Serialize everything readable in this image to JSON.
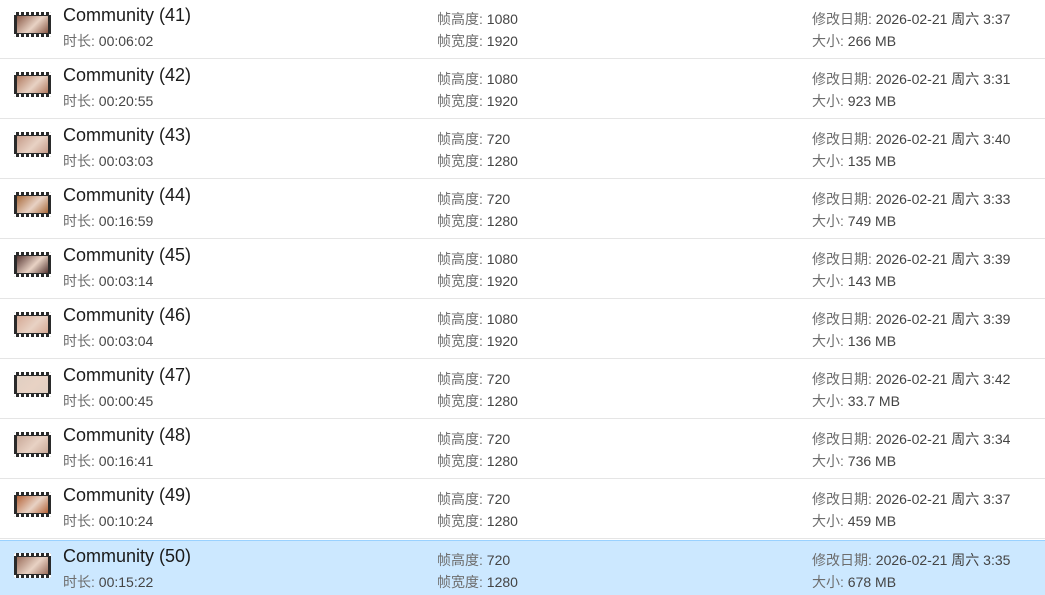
{
  "labels": {
    "duration": "时长:",
    "frame_height": "帧高度:",
    "frame_width": "帧宽度:",
    "modified": "修改日期:",
    "size": "大小:"
  },
  "colors": {
    "selected_background": "#cce8ff",
    "selected_border": "#99d1ff",
    "row_divider": "#e5e5e5"
  },
  "files": [
    {
      "name": "Community (41)",
      "duration": "00:06:02",
      "frame_height": "1080",
      "frame_width": "1920",
      "modified": "2026-02-21 周六 3:37",
      "size": "266 MB",
      "selected": false,
      "thumb_icon": "video-thumbnail-icon",
      "thumb_color": "#8a5a48"
    },
    {
      "name": "Community (42)",
      "duration": "00:20:55",
      "frame_height": "1080",
      "frame_width": "1920",
      "modified": "2026-02-21 周六 3:31",
      "size": "923 MB",
      "selected": false,
      "thumb_icon": "video-thumbnail-icon",
      "thumb_color": "#b07a60"
    },
    {
      "name": "Community (43)",
      "duration": "00:03:03",
      "frame_height": "720",
      "frame_width": "1280",
      "modified": "2026-02-21 周六 3:40",
      "size": "135 MB",
      "selected": false,
      "thumb_icon": "video-thumbnail-icon",
      "thumb_color": "#c49a88"
    },
    {
      "name": "Community (44)",
      "duration": "00:16:59",
      "frame_height": "720",
      "frame_width": "1280",
      "modified": "2026-02-21 周六 3:33",
      "size": "749 MB",
      "selected": false,
      "thumb_icon": "video-thumbnail-icon",
      "thumb_color": "#a86a3c"
    },
    {
      "name": "Community (45)",
      "duration": "00:03:14",
      "frame_height": "1080",
      "frame_width": "1920",
      "modified": "2026-02-21 周六 3:39",
      "size": "143 MB",
      "selected": false,
      "thumb_icon": "video-thumbnail-icon",
      "thumb_color": "#5a3a36"
    },
    {
      "name": "Community (46)",
      "duration": "00:03:04",
      "frame_height": "1080",
      "frame_width": "1920",
      "modified": "2026-02-21 周六 3:39",
      "size": "136 MB",
      "selected": false,
      "thumb_icon": "video-thumbnail-icon",
      "thumb_color": "#d4a894"
    },
    {
      "name": "Community (47)",
      "duration": "00:00:45",
      "frame_height": "720",
      "frame_width": "1280",
      "modified": "2026-02-21 周六 3:42",
      "size": "33.7 MB",
      "selected": false,
      "thumb_icon": "video-thumbnail-icon",
      "thumb_color": "#e0cfc2"
    },
    {
      "name": "Community (48)",
      "duration": "00:16:41",
      "frame_height": "720",
      "frame_width": "1280",
      "modified": "2026-02-21 周六 3:34",
      "size": "736 MB",
      "selected": false,
      "thumb_icon": "video-thumbnail-icon",
      "thumb_color": "#c8a898"
    },
    {
      "name": "Community (49)",
      "duration": "00:10:24",
      "frame_height": "720",
      "frame_width": "1280",
      "modified": "2026-02-21 周六 3:37",
      "size": "459 MB",
      "selected": false,
      "thumb_icon": "video-thumbnail-icon",
      "thumb_color": "#b4643a"
    },
    {
      "name": "Community (50)",
      "duration": "00:15:22",
      "frame_height": "720",
      "frame_width": "1280",
      "modified": "2026-02-21 周六 3:35",
      "size": "678 MB",
      "selected": true,
      "thumb_icon": "video-thumbnail-icon",
      "thumb_color": "#9a6e5c"
    }
  ]
}
